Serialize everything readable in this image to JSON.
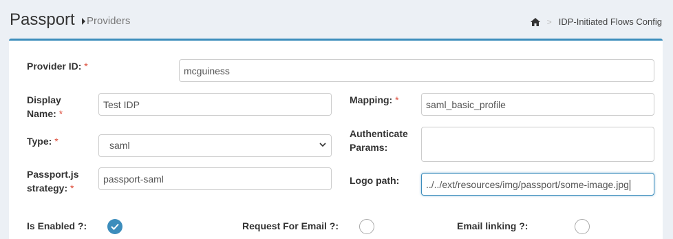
{
  "header": {
    "title": "Passport",
    "subtitle": "Providers"
  },
  "breadcrumb": {
    "separator": ">",
    "current": "IDP-Initiated Flows Config"
  },
  "form": {
    "required_mark": "*",
    "provider_id": {
      "label": "Provider ID:",
      "value": "mcguiness"
    },
    "display_name": {
      "label_line1": "Display",
      "label_line2": "Name:",
      "value": "Test IDP"
    },
    "type": {
      "label": "Type:",
      "value": "saml"
    },
    "strategy": {
      "label_line1": "Passport.js",
      "label_line2": "strategy:",
      "value": "passport-saml"
    },
    "mapping": {
      "label": "Mapping:",
      "value": "saml_basic_profile"
    },
    "auth_params": {
      "label_line1": "Authenticate",
      "label_line2": "Params:",
      "value": ""
    },
    "logo_path": {
      "label": "Logo path:",
      "value": "../../ext/resources/img/passport/some-image.jpg"
    },
    "is_enabled": {
      "label": "Is Enabled ?:",
      "checked": true
    },
    "request_email": {
      "label": "Request For Email ?:",
      "checked": false
    },
    "email_linking": {
      "label": "Email linking ?:",
      "checked": false
    }
  },
  "colors": {
    "accent": "#3c8dbc",
    "required": "#dd4b39"
  }
}
